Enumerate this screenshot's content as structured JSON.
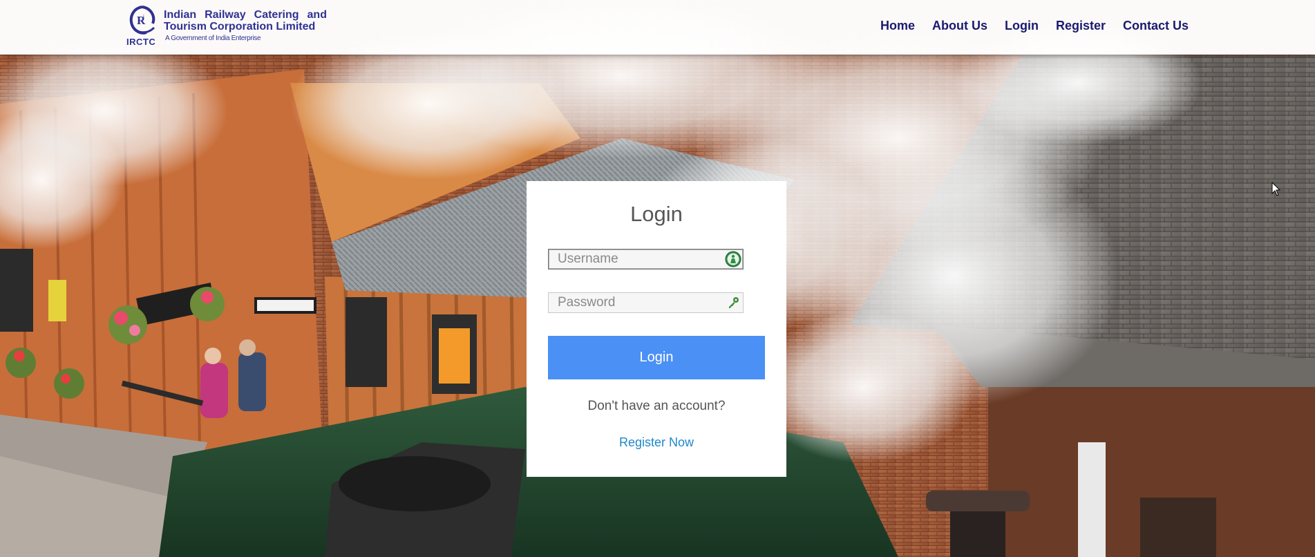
{
  "header": {
    "logo": {
      "abbr": "IRCTC",
      "name_line1_words": [
        "Indian",
        "Railway",
        "Catering",
        "and"
      ],
      "name_line2": "Tourism Corporation Limited",
      "tagline": "A Government of India Enterprise"
    },
    "nav": [
      {
        "label": "Home"
      },
      {
        "label": "About Us"
      },
      {
        "label": "Login"
      },
      {
        "label": "Register"
      },
      {
        "label": "Contact Us"
      }
    ]
  },
  "login_form": {
    "title": "Login",
    "username_placeholder": "Username",
    "password_placeholder": "Password",
    "submit_label": "Login",
    "no_account_text": "Don't have an account?",
    "register_link": "Register Now"
  },
  "colors": {
    "brand": "#2e3192",
    "nav_text": "#1a1a6e",
    "button": "#4a90f5",
    "link": "#1e88c8",
    "card_bg": "#ffffff"
  },
  "icons": {
    "username": "person-badge-icon",
    "password": "key-icon"
  }
}
